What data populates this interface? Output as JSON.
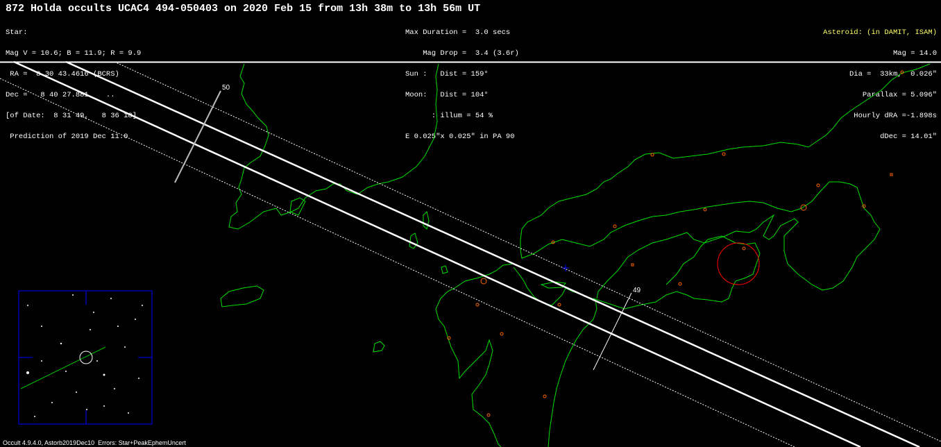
{
  "title": "872 Holda occults UCAC4 494-050403 on 2020 Feb 15 from 13h 38m to 13h 56m UT",
  "star_block": {
    "l1": "Star:",
    "l2": "Mag V = 10.6; B = 11.9; R = 9.9",
    "l3": " RA =  8 30 43.4616 (BCRS)",
    "l4": "Dec =   8 40 27.881    ..",
    "l5": "[of Date:  8 31 49,   8 36 18]",
    "l6": " Prediction of 2019 Dec 11.0"
  },
  "mid_block": {
    "l1": "Max Duration =  3.0 secs",
    "l2": "    Mag Drop =  3.4 (3.6r)",
    "l3": "Sun :   Dist = 159°",
    "l4": "Moon:   Dist = 104°",
    "l5": "      : illum = 54 %",
    "l6": "E 0.025\"x 0.025\" in PA 90"
  },
  "ast_block": {
    "l1": "Asteroid: (in DAMIT, ISAM)",
    "l2": "Mag = 14.0",
    "l3": "Dia =  33km,  0.026\"",
    "l4": "Parallax = 5.096\"",
    "l5": "Hourly dRA =-1.898s",
    "l6": "dDec = 14.01\""
  },
  "labels": {
    "t50": "50",
    "t49": "49"
  },
  "footer": "Occult 4.9.4.0, Astorb2019Dec10  Errors: Star+PeakEphemUncert",
  "colors": {
    "coast": "#00e000",
    "path": "#ffffff",
    "city": "#ff6600",
    "circle": "#ff0000",
    "asteroid_text": "#ffff66",
    "finder_box": "#0000ff"
  }
}
